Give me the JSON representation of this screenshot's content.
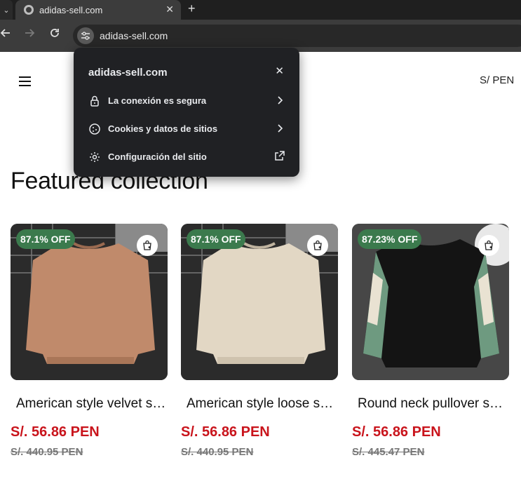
{
  "browser": {
    "tab_title": "adidas-sell.com",
    "tab_close": "✕",
    "new_tab": "+",
    "url": "adidas-sell.com"
  },
  "site_popup": {
    "title": "adidas-sell.com",
    "close": "✕",
    "items": [
      {
        "label": "La conexión es segura",
        "icon": "lock-icon"
      },
      {
        "label": "Cookies y datos de sitios",
        "icon": "cookie-icon"
      },
      {
        "label": "Configuración del sitio",
        "icon": "gear-icon"
      }
    ]
  },
  "header": {
    "currency": "S/ PEN"
  },
  "section": {
    "title": "Featured collection"
  },
  "products": [
    {
      "badge": "87.1% OFF",
      "name": "American style velvet sweatshirt",
      "price": "S/. 56.86 PEN",
      "old_price": "S/. 440.95 PEN",
      "color": "tan"
    },
    {
      "badge": "87.1% OFF",
      "name": "American style loose sweatshirt",
      "price": "S/. 56.86 PEN",
      "old_price": "S/. 440.95 PEN",
      "color": "beige"
    },
    {
      "badge": "87.23% OFF",
      "name": "Round neck pullover sweatshirt",
      "price": "S/. 56.86 PEN",
      "old_price": "S/. 445.47 PEN",
      "color": "black-green"
    }
  ],
  "colors": {
    "badge_green": "#3b7a4d",
    "price_red": "#c9141c"
  }
}
